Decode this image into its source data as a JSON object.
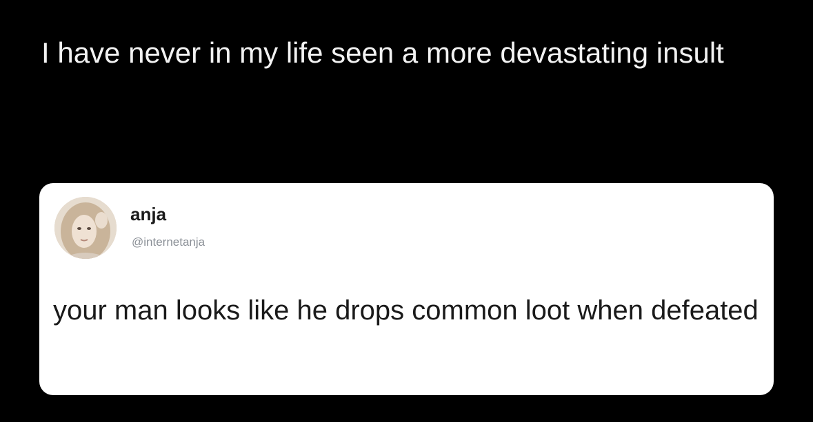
{
  "caption": {
    "text": "I have never in my life seen a more devastating insult",
    "color": "#f2f2f2"
  },
  "tweet": {
    "author_name": "anja",
    "author_handle": "@internetanja",
    "body": "your man looks like he drops common loot when defeated",
    "avatar_icon": "profile-photo"
  },
  "colors": {
    "background": "#000000",
    "card": "#ffffff",
    "text_dark": "#1a1a1a",
    "handle_gray": "#8a8f96"
  }
}
